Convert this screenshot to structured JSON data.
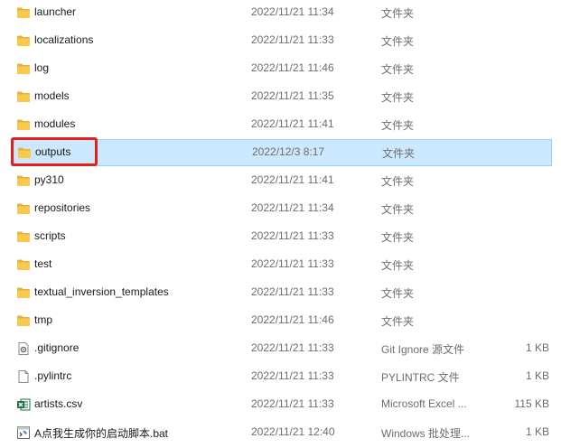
{
  "colors": {
    "selection_bg": "#cce8ff",
    "selection_border": "#99d1ff",
    "folder_yellow": "#f8c94a",
    "annotation_red": "#e0201b"
  },
  "files": [
    {
      "name": "launcher",
      "date": "2022/11/21 11:34",
      "type": "文件夹",
      "size": "",
      "icon": "folder-icon"
    },
    {
      "name": "localizations",
      "date": "2022/11/21 11:33",
      "type": "文件夹",
      "size": "",
      "icon": "folder-icon"
    },
    {
      "name": "log",
      "date": "2022/11/21 11:46",
      "type": "文件夹",
      "size": "",
      "icon": "folder-icon"
    },
    {
      "name": "models",
      "date": "2022/11/21 11:35",
      "type": "文件夹",
      "size": "",
      "icon": "folder-icon"
    },
    {
      "name": "modules",
      "date": "2022/11/21 11:41",
      "type": "文件夹",
      "size": "",
      "icon": "folder-icon"
    },
    {
      "name": "outputs",
      "date": "2022/12/3 8:17",
      "type": "文件夹",
      "size": "",
      "icon": "folder-icon",
      "selected": true
    },
    {
      "name": "py310",
      "date": "2022/11/21 11:41",
      "type": "文件夹",
      "size": "",
      "icon": "folder-icon"
    },
    {
      "name": "repositories",
      "date": "2022/11/21 11:34",
      "type": "文件夹",
      "size": "",
      "icon": "folder-icon"
    },
    {
      "name": "scripts",
      "date": "2022/11/21 11:33",
      "type": "文件夹",
      "size": "",
      "icon": "folder-icon"
    },
    {
      "name": "test",
      "date": "2022/11/21 11:33",
      "type": "文件夹",
      "size": "",
      "icon": "folder-icon"
    },
    {
      "name": "textual_inversion_templates",
      "date": "2022/11/21 11:33",
      "type": "文件夹",
      "size": "",
      "icon": "folder-icon"
    },
    {
      "name": "tmp",
      "date": "2022/11/21 11:46",
      "type": "文件夹",
      "size": "",
      "icon": "folder-icon"
    },
    {
      "name": ".gitignore",
      "date": "2022/11/21 11:33",
      "type": "Git Ignore 源文件",
      "size": "1 KB",
      "icon": "gitignore-file-icon"
    },
    {
      "name": ".pylintrc",
      "date": "2022/11/21 11:33",
      "type": "PYLINTRC 文件",
      "size": "1 KB",
      "icon": "blank-file-icon"
    },
    {
      "name": "artists.csv",
      "date": "2022/11/21 11:33",
      "type": "Microsoft Excel ...",
      "size": "115 KB",
      "icon": "excel-file-icon"
    },
    {
      "name": "A点我生成你的启动脚本.bat",
      "date": "2022/11/21 12:40",
      "type": "Windows 批处理...",
      "size": "1 KB",
      "icon": "batch-file-icon"
    }
  ]
}
